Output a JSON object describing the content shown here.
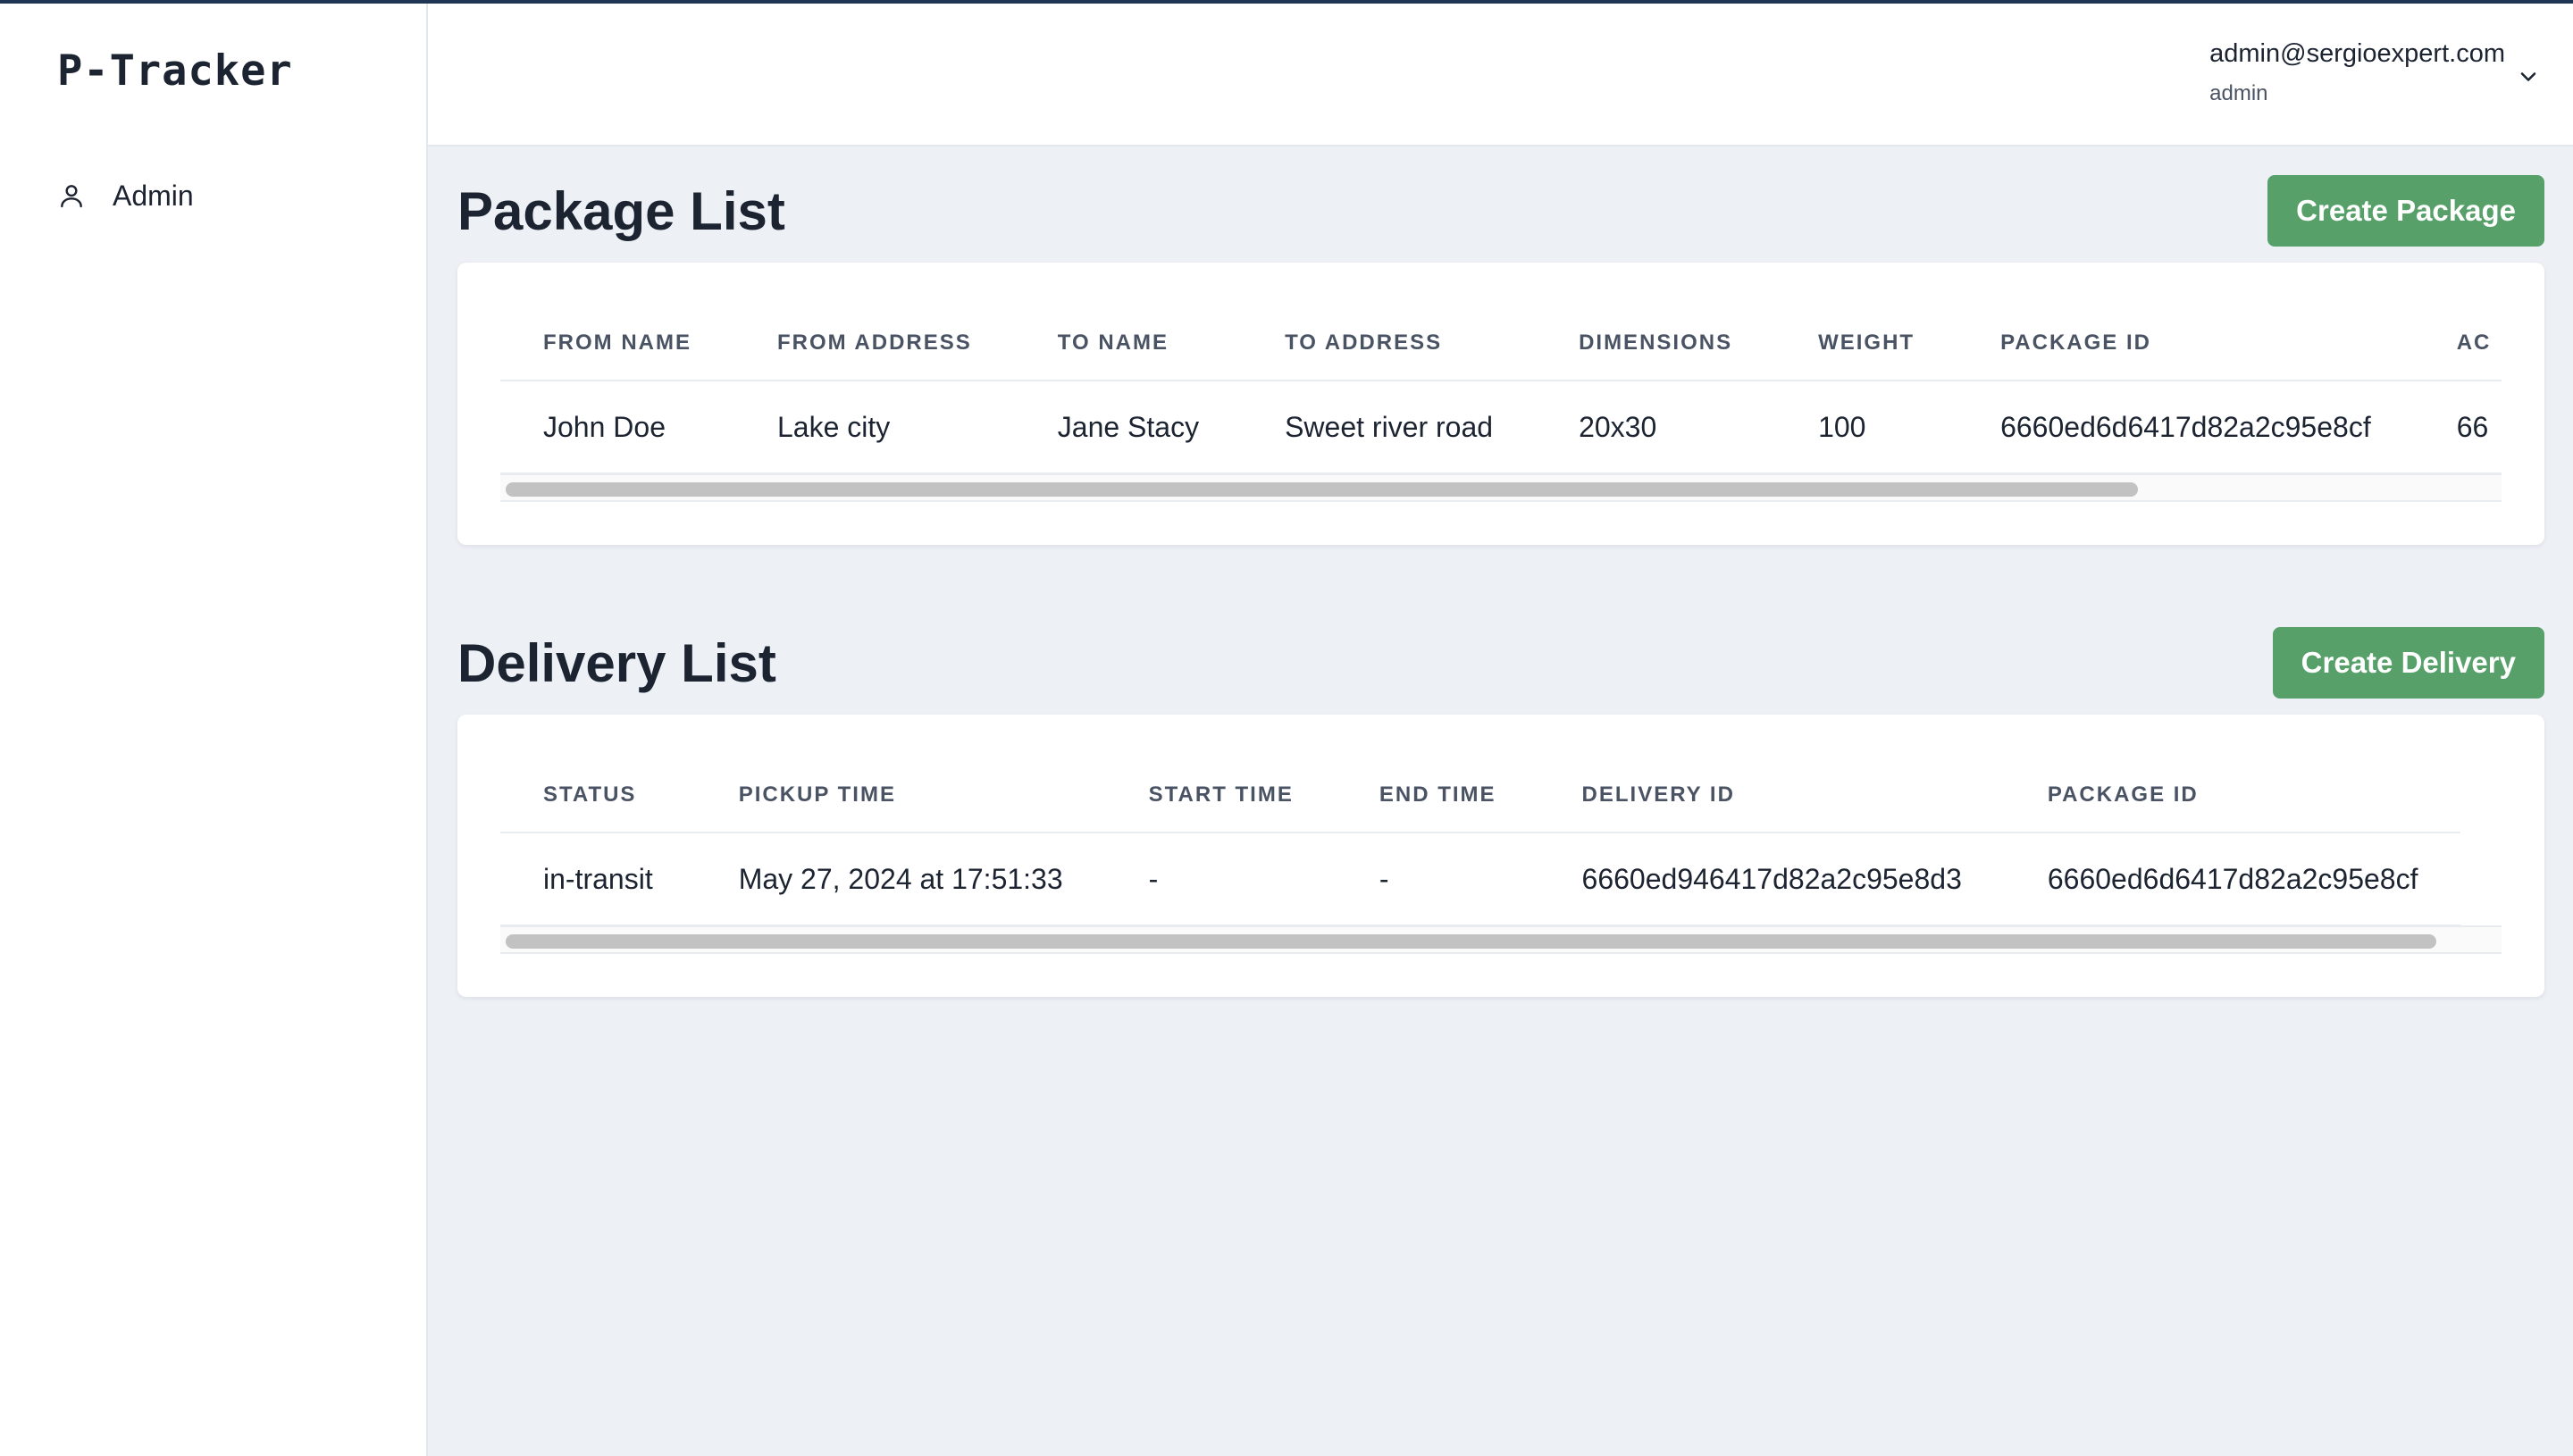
{
  "app": {
    "logo": "P-Tracker"
  },
  "sidebar": {
    "items": [
      {
        "label": "Admin",
        "icon": "user-icon"
      }
    ]
  },
  "header": {
    "user_email": "admin@sergioexpert.com",
    "user_role": "admin",
    "menu_icon": "chevron-down-icon"
  },
  "packages": {
    "title": "Package List",
    "create_label": "Create Package",
    "columns": [
      "FROM NAME",
      "FROM ADDRESS",
      "TO NAME",
      "TO ADDRESS",
      "DIMENSIONS",
      "WEIGHT",
      "PACKAGE ID",
      "AC"
    ],
    "rows": [
      [
        "John Doe",
        "Lake city",
        "Jane Stacy",
        "Sweet river road",
        "20x30",
        "100",
        "6660ed6d6417d82a2c95e8cf",
        "66"
      ]
    ],
    "scroll_fraction": 0.82
  },
  "deliveries": {
    "title": "Delivery List",
    "create_label": "Create Delivery",
    "columns": [
      "STATUS",
      "PICKUP TIME",
      "START TIME",
      "END TIME",
      "DELIVERY ID",
      "PACKAGE ID"
    ],
    "rows": [
      [
        "in-transit",
        "May 27, 2024 at 17:51:33",
        "-",
        "-",
        "6660ed946417d82a2c95e8d3",
        "6660ed6d6417d82a2c95e8cf"
      ]
    ],
    "scroll_fraction": 0.97
  },
  "colors": {
    "accent": "#57a06a",
    "topline": "#1f3554",
    "background": "#edf1f6"
  }
}
